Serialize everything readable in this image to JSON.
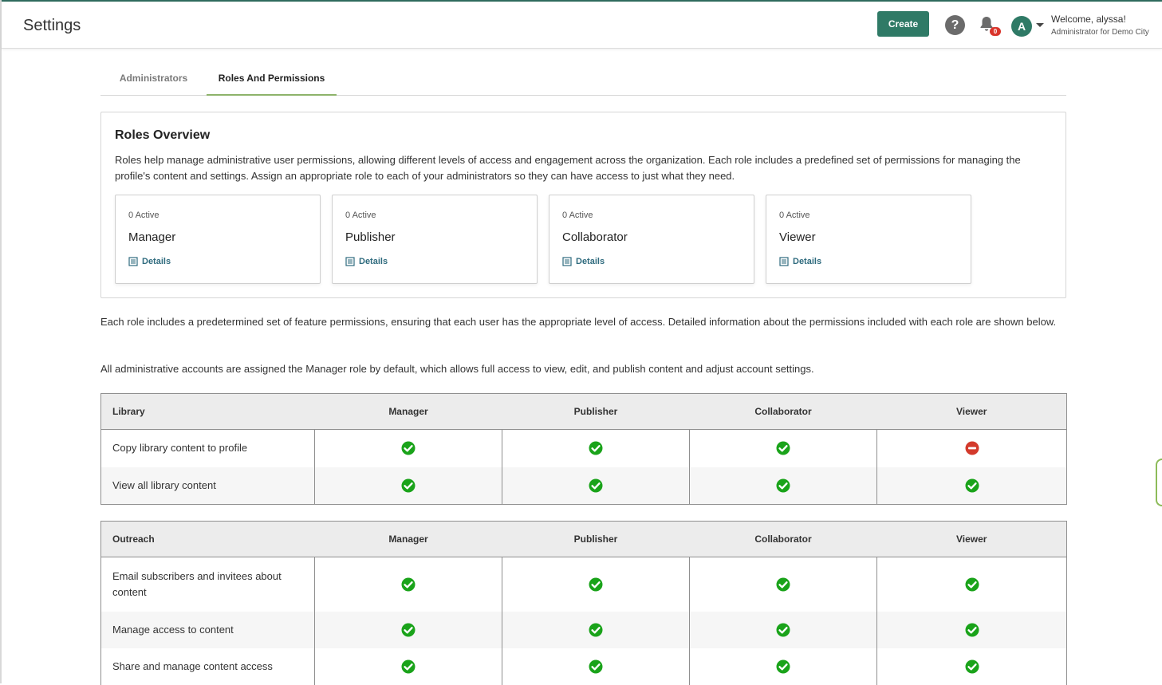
{
  "header": {
    "title": "Settings",
    "create_label": "Create",
    "help_icon": "question-circle-icon",
    "notification_count": "0",
    "avatar_initial": "A",
    "welcome": "Welcome, alyssa!",
    "role_line": "Administrator for Demo City",
    "accent_color": "#2f7a66"
  },
  "tabs": [
    {
      "label": "Administrators",
      "active": false
    },
    {
      "label": "Roles And Permissions",
      "active": true
    }
  ],
  "overview": {
    "title": "Roles Overview",
    "description": "Roles help manage administrative user permissions, allowing different levels of access and engagement across the organization. Each role includes a predefined set of permissions for managing the profile's content and settings. Assign an appropriate role to each of your administrators so they can have access to just what they need.",
    "roles": [
      {
        "active": "0 Active",
        "name": "Manager",
        "details": "Details"
      },
      {
        "active": "0 Active",
        "name": "Publisher",
        "details": "Details"
      },
      {
        "active": "0 Active",
        "name": "Collaborator",
        "details": "Details"
      },
      {
        "active": "0 Active",
        "name": "Viewer",
        "details": "Details"
      }
    ]
  },
  "info": {
    "paragraph1": "Each role includes a predetermined set of feature permissions, ensuring that each user has the appropriate level of access. Detailed information about the permissions included with each role are shown below.",
    "paragraph2": "All administrative accounts are assigned the Manager role by default, which allows full access to view, edit, and publish content and adjust account settings."
  },
  "tables": [
    {
      "section": "Library",
      "columns": [
        "Manager",
        "Publisher",
        "Collaborator",
        "Viewer"
      ],
      "rows": [
        {
          "feature": "Copy library content to profile",
          "perms": [
            "allowed",
            "allowed",
            "allowed",
            "denied"
          ]
        },
        {
          "feature": "View all library content",
          "perms": [
            "allowed",
            "allowed",
            "allowed",
            "allowed"
          ]
        }
      ]
    },
    {
      "section": "Outreach",
      "columns": [
        "Manager",
        "Publisher",
        "Collaborator",
        "Viewer"
      ],
      "rows": [
        {
          "feature": "Email subscribers and invitees about content",
          "perms": [
            "allowed",
            "allowed",
            "allowed",
            "allowed"
          ]
        },
        {
          "feature": "Manage access to content",
          "perms": [
            "allowed",
            "allowed",
            "allowed",
            "allowed"
          ]
        },
        {
          "feature": "Share and manage content access",
          "perms": [
            "allowed",
            "allowed",
            "allowed",
            "allowed"
          ]
        }
      ]
    }
  ],
  "status_icons": {
    "allowed": "check-circle-icon",
    "denied": "minus-circle-icon"
  },
  "colors": {
    "allowed": "#1aa31a",
    "denied": "#d33a2c",
    "tab_underline": "#8db36a"
  }
}
